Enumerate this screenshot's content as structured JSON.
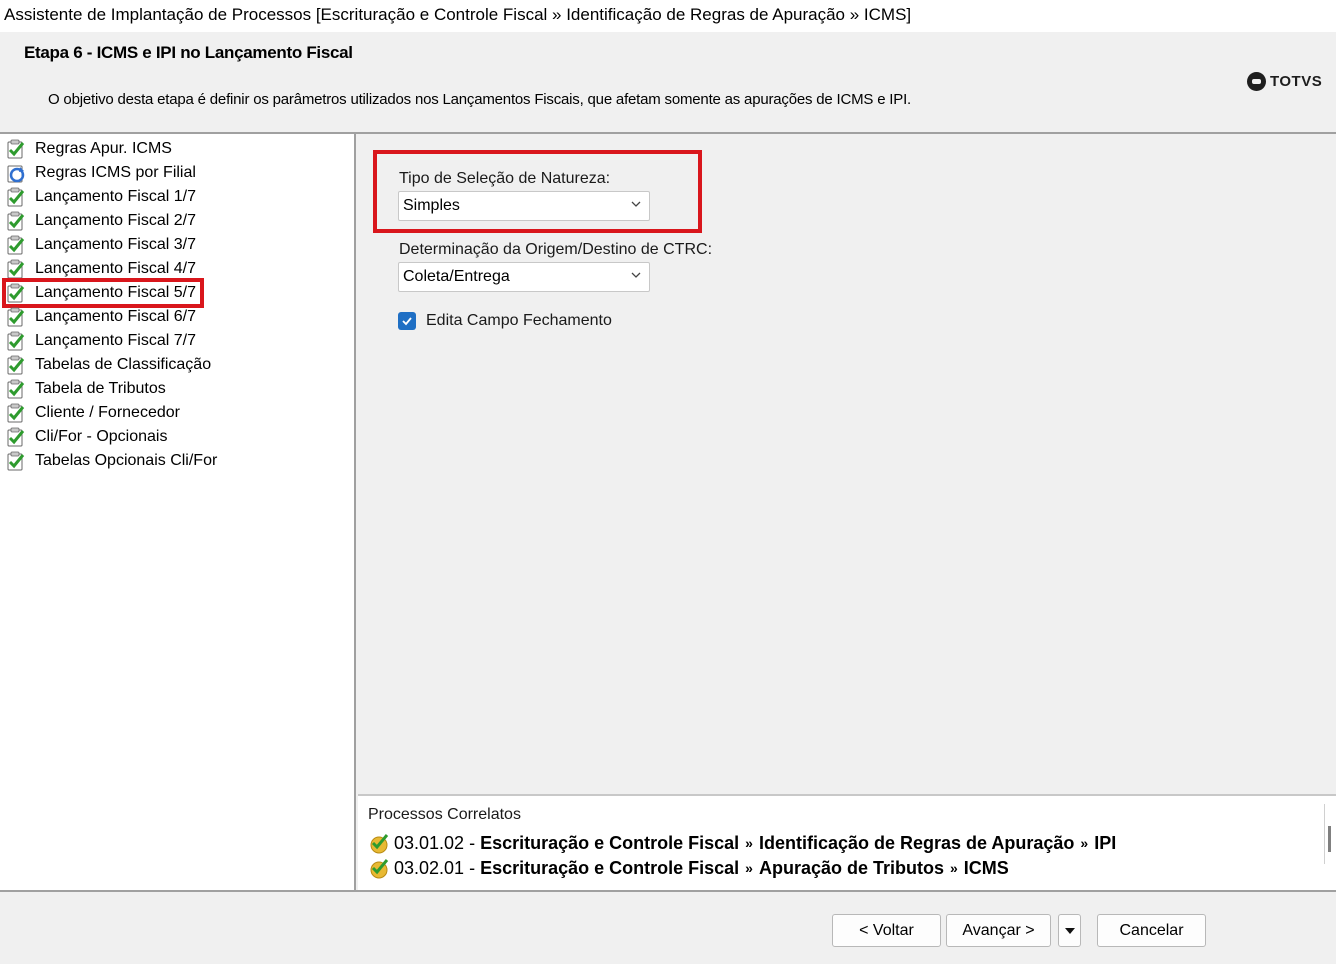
{
  "window": {
    "title": "Assistente de Implantação de Processos [Escrituração e Controle Fiscal » Identificação de Regras de Apuração » ICMS]"
  },
  "header": {
    "step_title": "Etapa 6 - ICMS e IPI no Lançamento Fiscal",
    "description": "O objetivo desta etapa é definir os parâmetros utilizados nos Lançamentos Fiscais, que afetam somente as apurações de ICMS e IPI.",
    "logo_text": "TOTVS"
  },
  "tree": {
    "items": [
      {
        "label": "Regras Apur. ICMS",
        "icon": "checked-page-icon"
      },
      {
        "label": "Regras ICMS por Filial",
        "icon": "refresh-page-icon"
      },
      {
        "label": "Lançamento Fiscal 1/7",
        "icon": "checked-page-icon"
      },
      {
        "label": "Lançamento Fiscal 2/7",
        "icon": "checked-page-icon"
      },
      {
        "label": "Lançamento Fiscal 3/7",
        "icon": "checked-page-icon"
      },
      {
        "label": "Lançamento Fiscal 4/7",
        "icon": "checked-page-icon"
      },
      {
        "label": "Lançamento Fiscal 5/7",
        "icon": "checked-page-icon",
        "highlighted": true
      },
      {
        "label": "Lançamento Fiscal 6/7",
        "icon": "checked-page-icon"
      },
      {
        "label": "Lançamento Fiscal 7/7",
        "icon": "checked-page-icon"
      },
      {
        "label": "Tabelas de Classificação",
        "icon": "checked-page-icon"
      },
      {
        "label": "Tabela de Tributos",
        "icon": "checked-page-icon"
      },
      {
        "label": "Cliente / Fornecedor",
        "icon": "checked-page-icon"
      },
      {
        "label": "Cli/For - Opcionais",
        "icon": "checked-page-icon"
      },
      {
        "label": "Tabelas Opcionais Cli/For",
        "icon": "checked-page-icon"
      }
    ]
  },
  "form": {
    "natureza_label": "Tipo de Seleção de Natureza:",
    "natureza_value": "Simples",
    "ctrc_label": "Determinação da Origem/Destino de CTRC:",
    "ctrc_value": "Coleta/Entrega",
    "edita_label": "Edita Campo Fechamento",
    "edita_checked": true
  },
  "related": {
    "title": "Processos Correlatos",
    "links": [
      {
        "code": "03.01.02",
        "parts": [
          "Escrituração e Controle Fiscal",
          "Identificação de Regras de Apuração",
          "IPI"
        ]
      },
      {
        "code": "03.02.01",
        "parts": [
          "Escrituração e Controle Fiscal",
          "Apuração de Tributos",
          "ICMS"
        ]
      }
    ],
    "separator": "»"
  },
  "footer": {
    "back_label": "< Voltar",
    "next_label": "Avançar >",
    "cancel_label": "Cancelar"
  },
  "colors": {
    "highlight_red": "#d9161c",
    "checkbox_blue": "#1f6fc4",
    "check_green": "#2e9b2e"
  }
}
